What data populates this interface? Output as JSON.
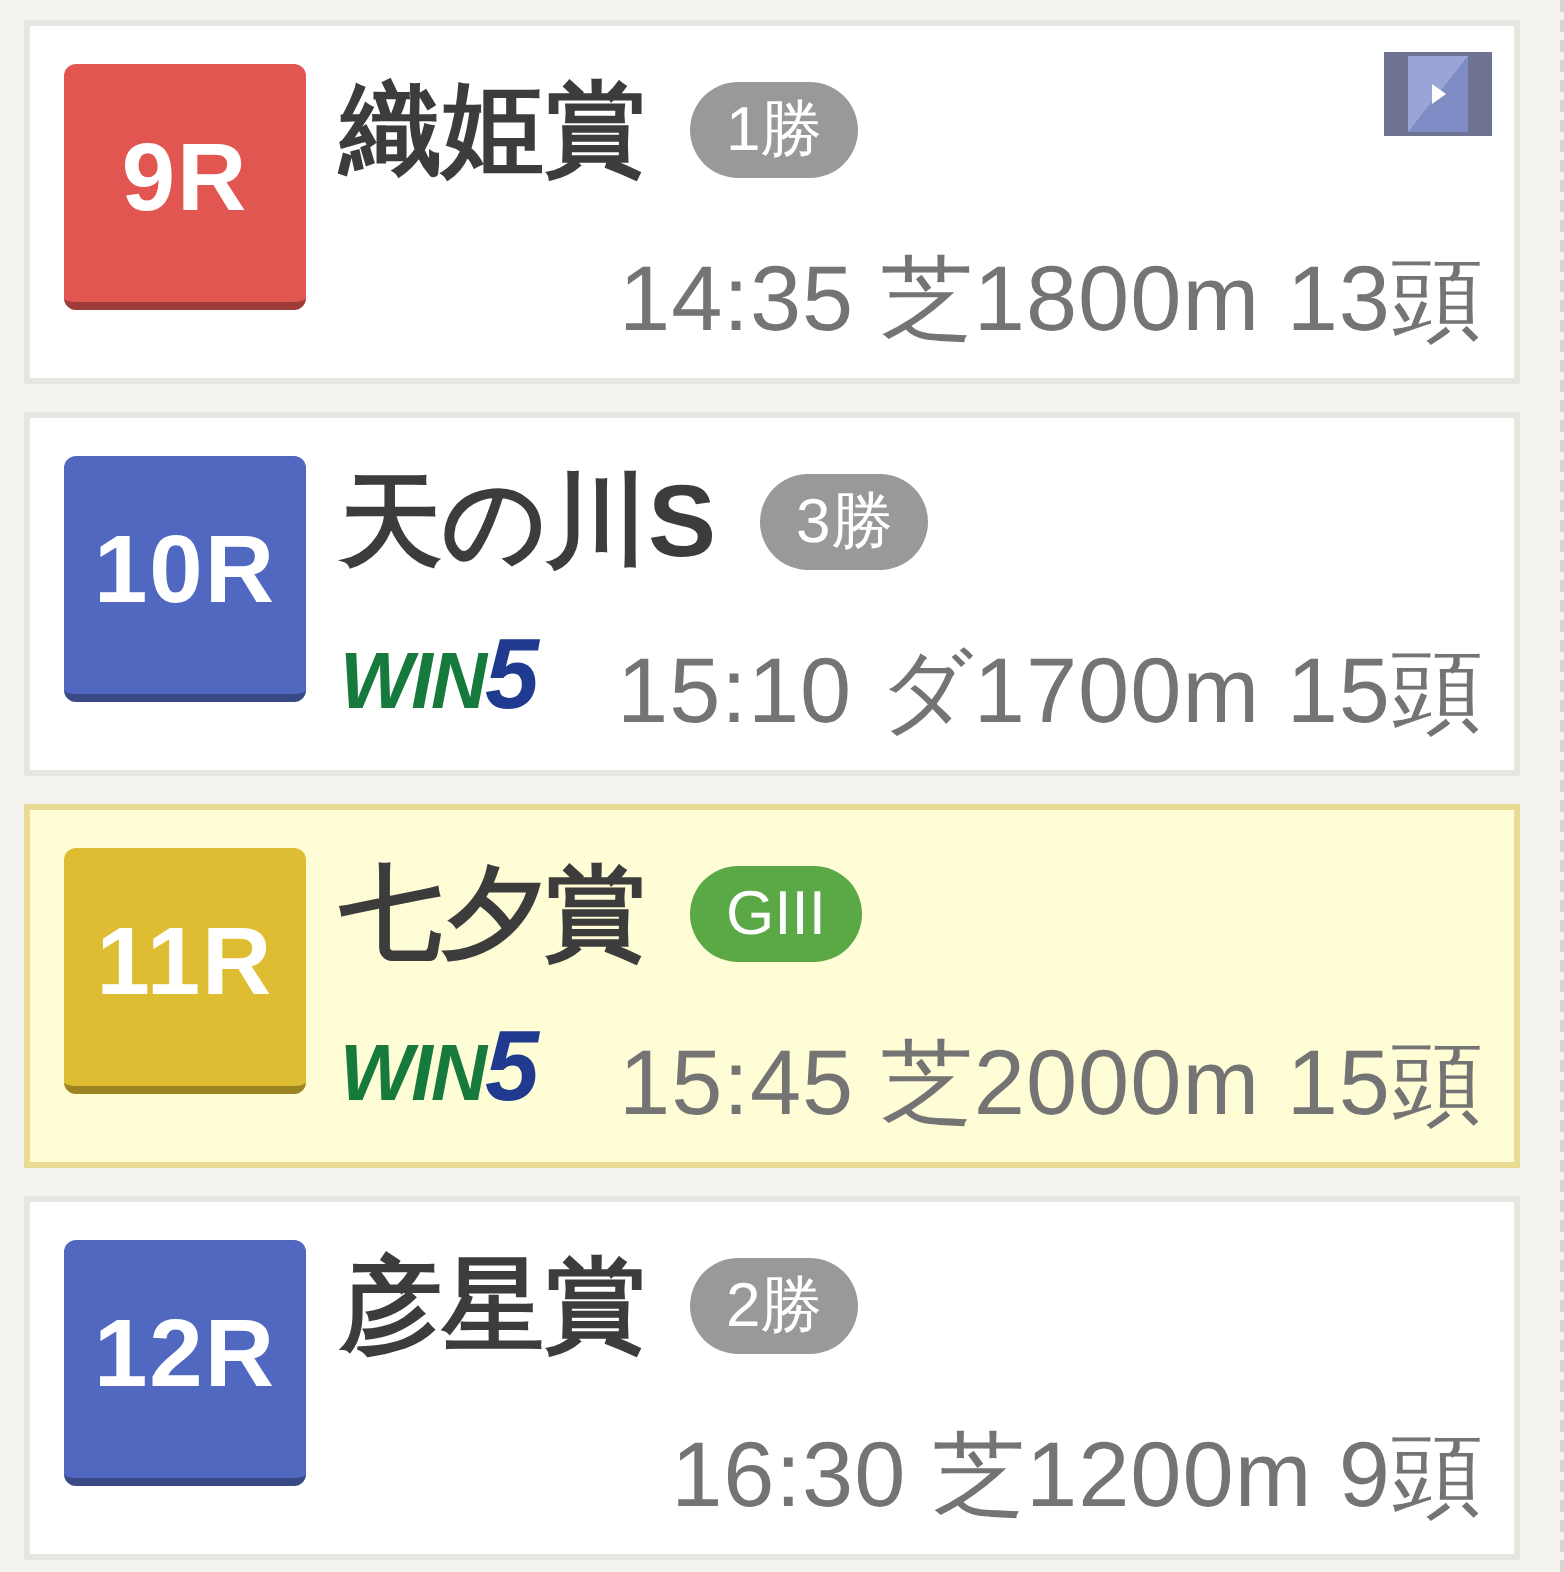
{
  "races": [
    {
      "number": "9R",
      "color": "#e15651",
      "name": "織姫賞",
      "grade": {
        "label": "1勝",
        "color": "#999999"
      },
      "has_video": true,
      "selected": false,
      "info": "14:35 芝1800m 13頭"
    },
    {
      "number": "10R",
      "color": "#5068bf",
      "name": "天の川S",
      "grade": {
        "label": "3勝",
        "color": "#999999"
      },
      "has_video": false,
      "selected": false,
      "win5_logo": {
        "word": "WIN",
        "digit": "5"
      },
      "info": "15:10 ダ1700m 15頭"
    },
    {
      "number": "11R",
      "color": "#dfbd33",
      "name": "七夕賞",
      "grade": {
        "label": "GIII",
        "color": "#5aa846"
      },
      "has_video": false,
      "selected": true,
      "win5_logo": {
        "word": "WIN",
        "digit": "5"
      },
      "info": "15:45 芝2000m 15頭"
    },
    {
      "number": "12R",
      "color": "#5068bf",
      "name": "彦星賞",
      "grade": {
        "label": "2勝",
        "color": "#999999"
      },
      "has_video": false,
      "selected": false,
      "info": "16:30 芝1200m 9頭"
    }
  ]
}
